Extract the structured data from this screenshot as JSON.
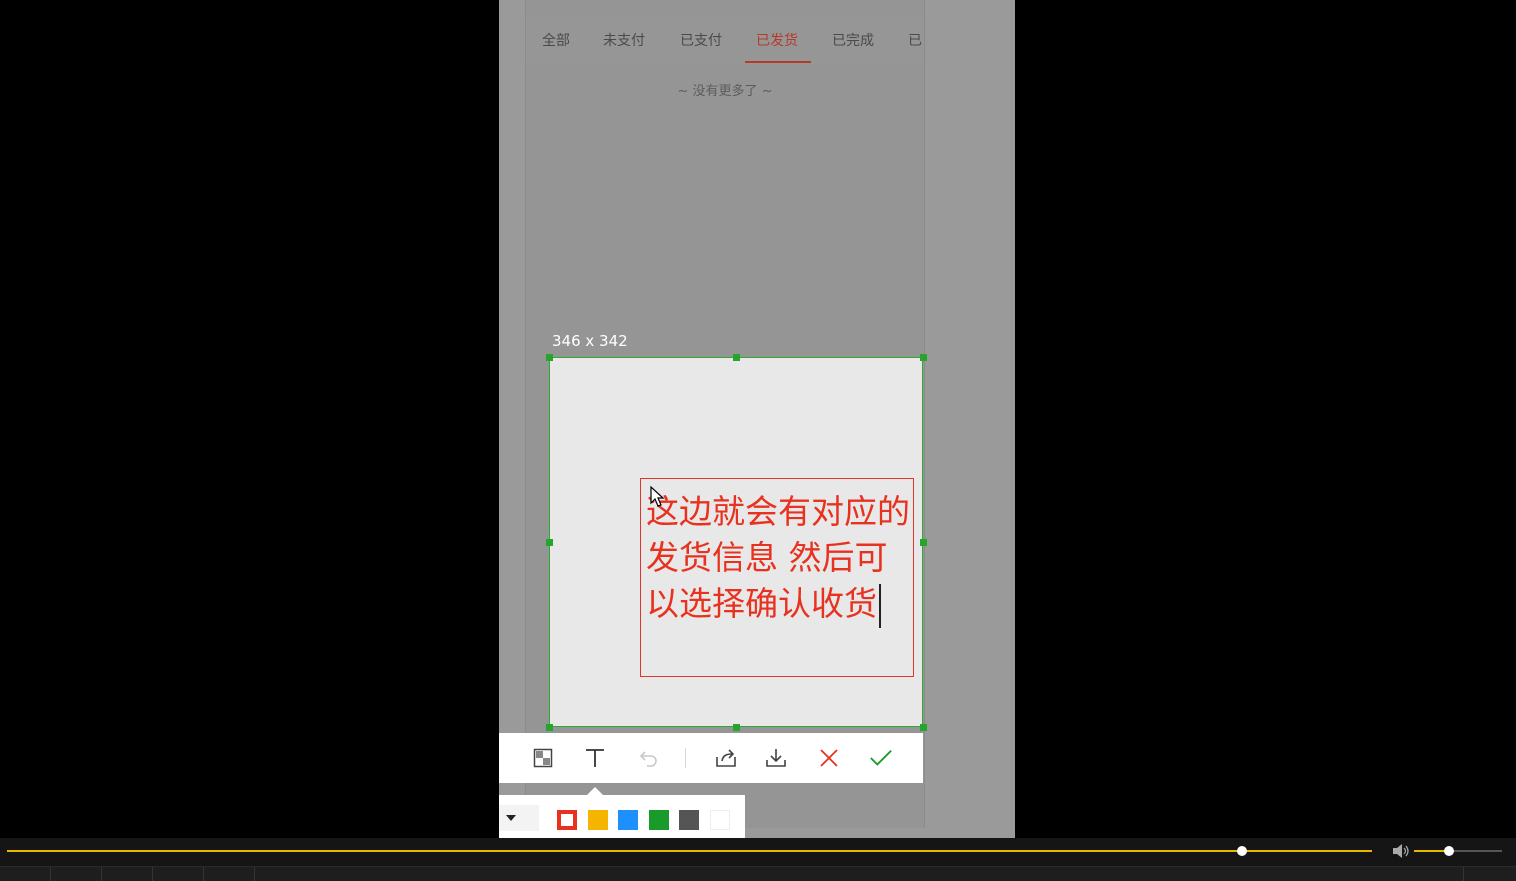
{
  "order_page": {
    "tabs": [
      {
        "label": "全部",
        "active": false
      },
      {
        "label": "未支付",
        "active": false
      },
      {
        "label": "已支付",
        "active": false
      },
      {
        "label": "已发货",
        "active": true
      },
      {
        "label": "已完成",
        "active": false
      },
      {
        "label": "已",
        "active": false
      }
    ],
    "no_more_text": "~ 没有更多了 ~"
  },
  "screenshot_tool": {
    "selection_size": "346 x 342",
    "annotation_text": "这边就会有对应的发货信息 然后可以选择确认收货",
    "toolbar": {
      "tools": [
        "mosaic-icon",
        "text-icon",
        "undo-icon",
        "share-icon",
        "download-icon",
        "cancel-icon",
        "confirm-icon"
      ]
    },
    "colors": [
      "#e8321f",
      "#f5b400",
      "#1e8fff",
      "#1a9a2a",
      "#555555",
      "#ffffff"
    ],
    "selected_color": "#e8321f"
  },
  "player": {
    "progress": 0.905,
    "volume": 0.4,
    "accent_color": "#e6b800"
  }
}
